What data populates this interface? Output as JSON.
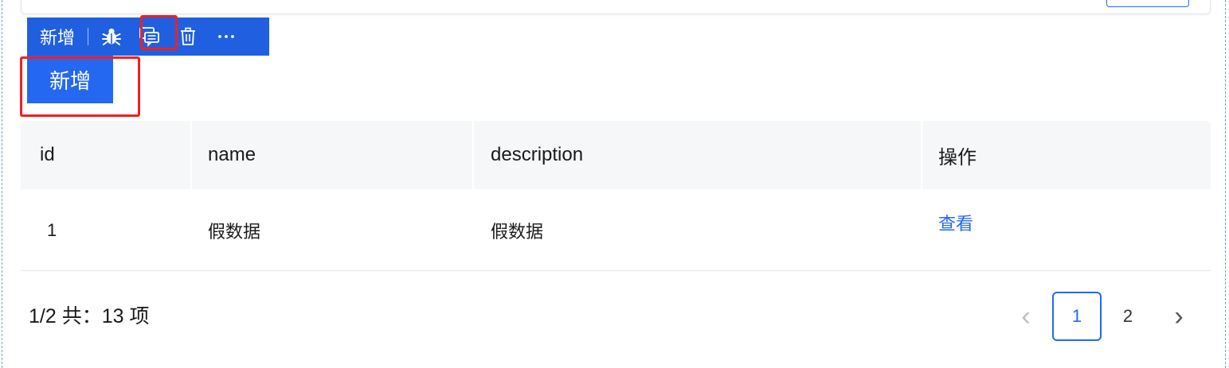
{
  "toolbar": {
    "label": "新增",
    "icons": [
      "bug-icon",
      "comment-icon",
      "trash-icon",
      "more-icon"
    ],
    "more_glyph": "···"
  },
  "add_button": {
    "label": "新增"
  },
  "table": {
    "columns": [
      "id",
      "name",
      "description",
      "操作"
    ],
    "rows": [
      {
        "id": "1",
        "name": "假数据",
        "description": "假数据",
        "action": "查看"
      }
    ]
  },
  "pagination": {
    "summary": "1/2 共：13 项",
    "pages": [
      "1",
      "2"
    ],
    "current_page": "1",
    "prev_glyph": "‹",
    "next_glyph": "›"
  },
  "colors": {
    "primary": "#2468f2",
    "toolbar_bg": "#2060e0",
    "highlight": "#ef2020"
  }
}
